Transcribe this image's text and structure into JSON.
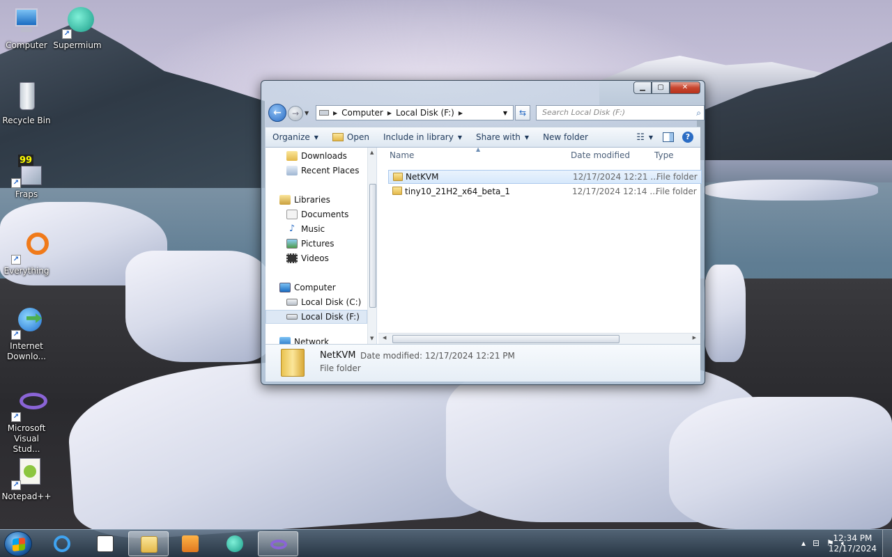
{
  "desktop": {
    "icons": [
      {
        "label": "Computer"
      },
      {
        "label": "Supermium"
      },
      {
        "label": "Recycle Bin"
      },
      {
        "label": "Fraps",
        "badge": "99"
      },
      {
        "label": "Everything"
      },
      {
        "label": "Internet Downlo..."
      },
      {
        "label": "Microsoft Visual Stud..."
      },
      {
        "label": "Notepad++"
      }
    ]
  },
  "explorer": {
    "address": {
      "segments": [
        "Computer",
        "Local Disk (F:)"
      ]
    },
    "search": {
      "placeholder": "Search Local Disk (F:)"
    },
    "toolbar": {
      "organize": "Organize",
      "open": "Open",
      "include": "Include in library",
      "share": "Share with",
      "new_folder": "New folder"
    },
    "nav": {
      "downloads": "Downloads",
      "recent": "Recent Places",
      "libraries": "Libraries",
      "documents": "Documents",
      "music": "Music",
      "pictures": "Pictures",
      "videos": "Videos",
      "computer": "Computer",
      "disk_c": "Local Disk (C:)",
      "disk_f": "Local Disk (F:)",
      "network": "Network"
    },
    "columns": {
      "name": "Name",
      "date": "Date modified",
      "type": "Type"
    },
    "files": [
      {
        "name": "NetKVM",
        "date": "12/17/2024 12:21 ...",
        "type": "File folder"
      },
      {
        "name": "tiny10_21H2_x64_beta_1",
        "date": "12/17/2024 12:14 ...",
        "type": "File folder"
      }
    ],
    "details": {
      "name": "NetKVM",
      "date": "Date modified: 12/17/2024 12:21 PM",
      "type": "File folder"
    }
  },
  "taskbar": {
    "time": "12:34 PM",
    "date": "12/17/2024"
  },
  "colors": {
    "accent": "#2a6cc4",
    "selection": "#d6e8fb"
  }
}
